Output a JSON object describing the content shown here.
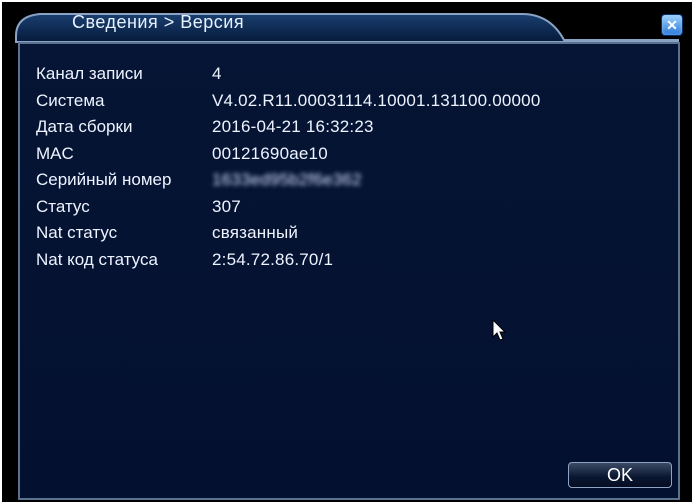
{
  "window": {
    "title": "Сведения > Версия",
    "close_glyph": "✕"
  },
  "info": {
    "rows": [
      {
        "label": "Канал записи",
        "value": "4"
      },
      {
        "label": "Система",
        "value": "V4.02.R11.00031114.10001.131100.00000"
      },
      {
        "label": "Дата сборки",
        "value": "2016-04-21 16:32:23"
      },
      {
        "label": "MAC",
        "value": "00121690ae10"
      },
      {
        "label": "Серийный номер",
        "value": "1633ed95b2f6e362"
      },
      {
        "label": "Статус",
        "value": "307"
      },
      {
        "label": "Nat статус",
        "value": "связанный"
      },
      {
        "label": "Nat код статуса",
        "value": "2:54.72.86.70/1"
      }
    ]
  },
  "buttons": {
    "ok_label": "OK"
  },
  "colors": {
    "background": "#041030",
    "title_tab": "#0a2a55",
    "border": "#5a7290",
    "text": "#eef3ff"
  }
}
